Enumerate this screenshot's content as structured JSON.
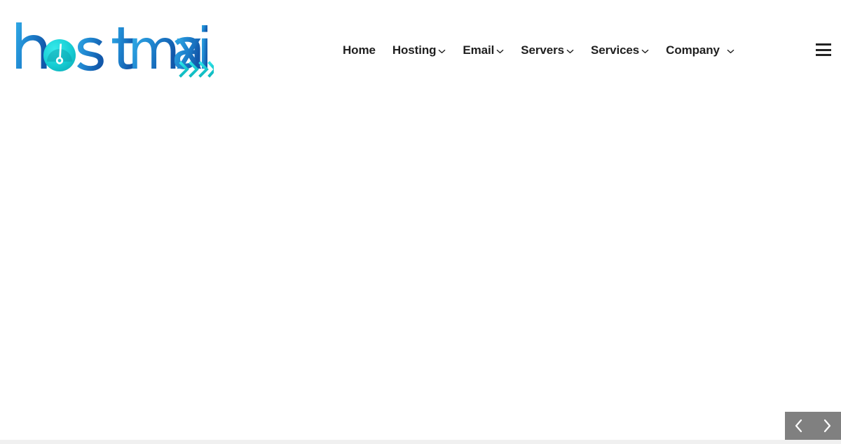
{
  "site": {
    "brand_name": "hostmaxi",
    "logo_icon": "speedometer-gauge-icon",
    "logo_accent_icon": "speed-chevrons-icon"
  },
  "colors": {
    "logo_blue_light": "#2aa3e0",
    "logo_blue_dark": "#1664b8",
    "logo_cyan": "#1fd6d6",
    "logo_teal": "#12c2c2",
    "nav_text": "#1f1f1f",
    "hamburger": "#232323",
    "carousel_bg": "#808080",
    "carousel_arrow": "#ffffff",
    "bottom_strip": "#f0f0f0",
    "page_bg": "#ffffff"
  },
  "header": {
    "nav": [
      {
        "label": "Home",
        "has_caret": false,
        "caret_icon": ""
      },
      {
        "label": "Hosting",
        "has_caret": true,
        "caret_icon": "chevron-down-icon"
      },
      {
        "label": "Email",
        "has_caret": true,
        "caret_icon": "chevron-down-icon"
      },
      {
        "label": "Servers",
        "has_caret": true,
        "caret_icon": "chevron-down-icon"
      },
      {
        "label": "Services",
        "has_caret": true,
        "caret_icon": "chevron-down-icon"
      },
      {
        "label": "Company",
        "has_caret": true,
        "caret_icon": "chevron-down-icon"
      }
    ],
    "menu_toggle": {
      "icon": "hamburger-menu-icon",
      "label": "Menu"
    }
  },
  "carousel": {
    "prev": {
      "icon": "chevron-left-icon",
      "label": "Previous"
    },
    "next": {
      "icon": "chevron-right-icon",
      "label": "Next"
    }
  }
}
